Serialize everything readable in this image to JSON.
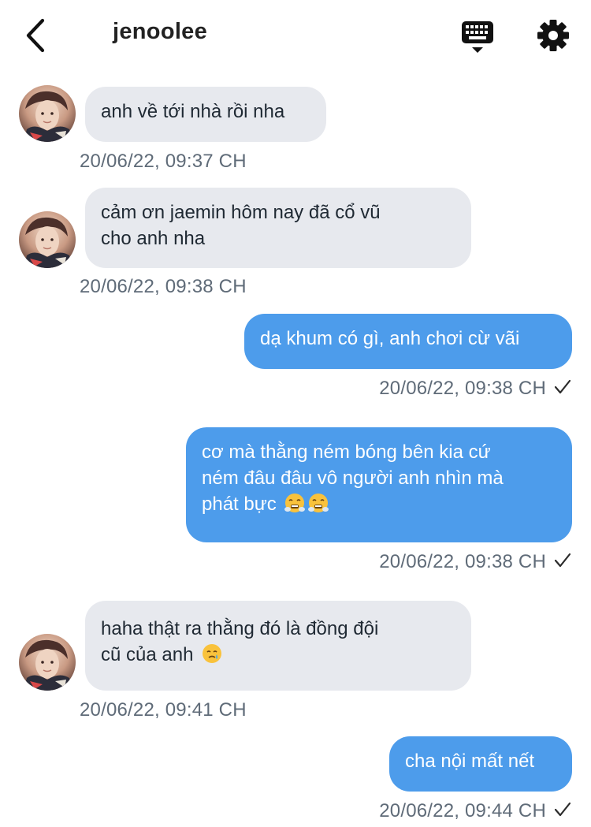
{
  "header": {
    "title": "jenoolee",
    "back_icon": "chevron-left-icon",
    "keyboard_icon": "keyboard-icon",
    "settings_icon": "gear-icon"
  },
  "colors": {
    "incoming_bubble": "#e7e9ee",
    "outgoing_bubble": "#4d9ceb",
    "timestamp": "#5f6b78"
  },
  "messages": [
    {
      "sender": "other",
      "text": "anh về tới nhà rồi nha",
      "time": "20/06/22, 09:37 CH"
    },
    {
      "sender": "other",
      "lines": [
        "cảm ơn jaemin hôm nay đã cổ vũ",
        "cho anh nha"
      ],
      "time": "20/06/22, 09:38 CH"
    },
    {
      "sender": "me",
      "text": "dạ khum có gì, anh chơi cừ vãi",
      "time": "20/06/22, 09:38 CH",
      "status_icon": "checkmark-icon"
    },
    {
      "sender": "me",
      "lines": [
        "cơ mà thằng ném bóng bên kia cứ",
        "ném đâu đâu vô người anh nhìn mà",
        "phát bực"
      ],
      "emojis": [
        "steam-face-emoji",
        "steam-face-emoji"
      ],
      "time": "20/06/22, 09:38 CH",
      "status_icon": "checkmark-icon"
    },
    {
      "sender": "other",
      "lines": [
        "haha thật ra thằng đó là đồng đội",
        "cũ của anh"
      ],
      "emojis": [
        "tearful-smile-emoji"
      ],
      "time": "20/06/22, 09:41 CH"
    },
    {
      "sender": "me",
      "text": "cha nội mất nết",
      "time": "20/06/22, 09:44 CH",
      "status_icon": "checkmark-icon"
    }
  ]
}
